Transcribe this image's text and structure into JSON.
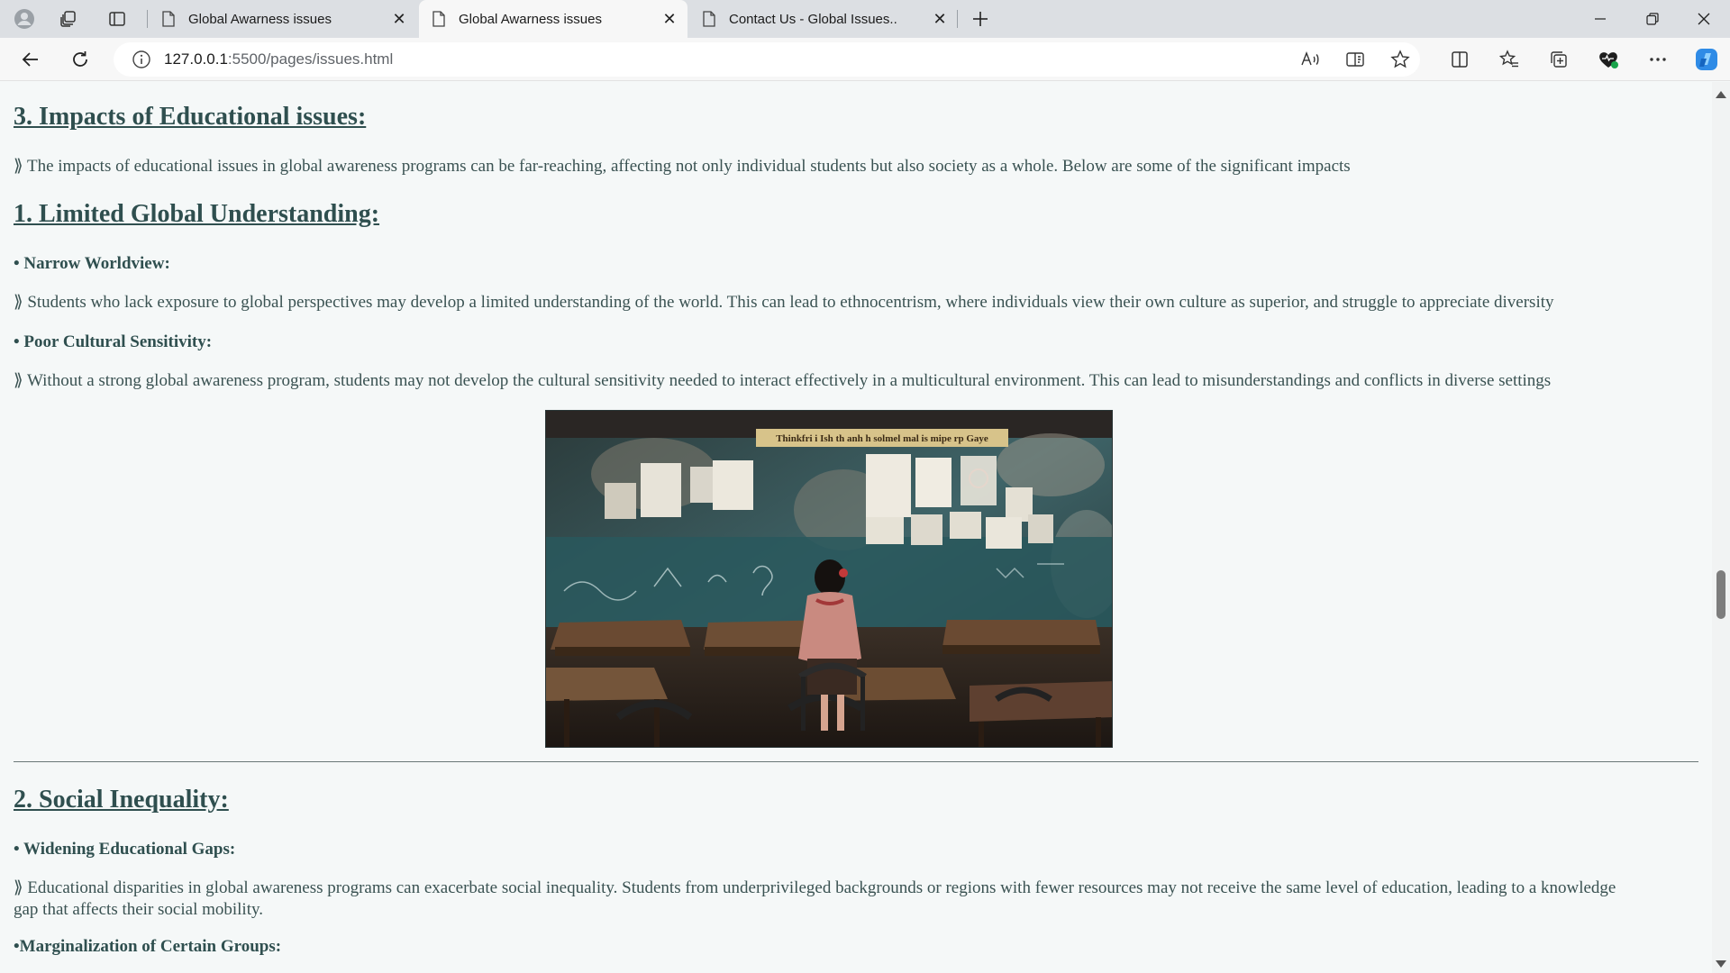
{
  "browser": {
    "tabs": [
      {
        "title": "Global Awarness issues",
        "active": false
      },
      {
        "title": "Global Awarness issues",
        "active": true
      },
      {
        "title": "Contact Us - Global Issues..",
        "active": false
      }
    ],
    "url_host": "127.0.0.1",
    "url_path": ":5500/pages/issues.html",
    "icons": {
      "profile": "profile-icon",
      "workspaces": "workspaces-icon",
      "tab_actions": "tab-actions-icon",
      "new_tab": "plus-icon",
      "back": "back-arrow-icon",
      "refresh": "refresh-icon",
      "site_info": "info-icon",
      "read_aloud": "read-aloud-icon",
      "immersive_reader": "immersive-reader-icon",
      "favorite": "star-icon",
      "split_screen": "split-screen-icon",
      "favorites": "favorites-list-icon",
      "collections": "collections-icon",
      "browser_essentials": "heart-pulse-icon",
      "more": "more-icon",
      "copilot": "copilot-icon"
    }
  },
  "page": {
    "section3_heading": "3. Impacts of Educational issues:",
    "section3_intro": "⟫ The impacts of educational issues in global awareness programs can be far-reaching, affecting not only individual students but also society as a whole. Below are some of the significant impacts",
    "impact1": {
      "heading": "1. Limited Global Understanding:",
      "point1_title": "• Narrow Worldview:",
      "point1_text": "⟫ Students who lack exposure to global perspectives may develop a limited understanding of the world. This can lead to ethnocentrism, where individuals view their own culture as superior, and struggle to appreciate diversity",
      "point2_title": "• Poor Cultural Sensitivity:",
      "point2_text": "⟫ Without a strong global awareness program, students may not develop the cultural sensitivity needed to interact effectively in a multicultural environment. This can lead to misunderstandings and conflicts in diverse settings",
      "image_banner": "Thinkfri i Ish th anh h solmel mal is mipe rp Gaye"
    },
    "impact2": {
      "heading": "2. Social Inequality:",
      "point1_title": "• Widening Educational Gaps:",
      "point1_text": "⟫ Educational disparities in global awareness programs can exacerbate social inequality. Students from underprivileged backgrounds or regions with fewer resources may not receive the same level of education, leading to a knowledge gap that affects their social mobility.",
      "point2_title": "•Marginalization of Certain Groups:"
    }
  }
}
